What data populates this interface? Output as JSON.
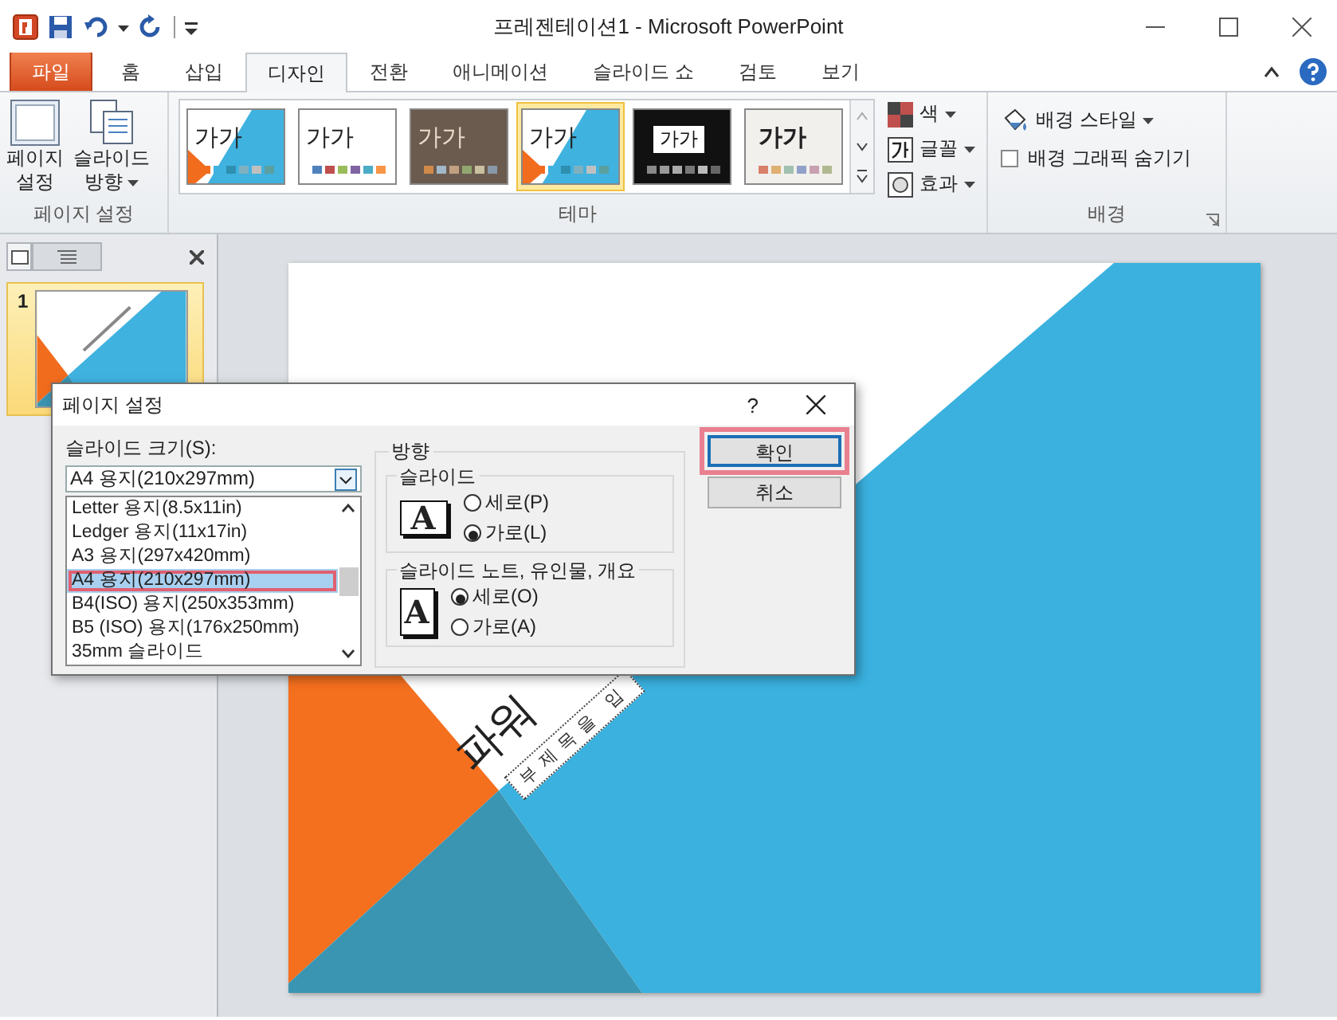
{
  "window": {
    "title": "프레젠테이션1 - Microsoft PowerPoint"
  },
  "tabs": [
    {
      "label": "파일",
      "kind": "file",
      "selected": false
    },
    {
      "label": "홈",
      "kind": "normal",
      "selected": false
    },
    {
      "label": "삽입",
      "kind": "normal",
      "selected": false
    },
    {
      "label": "디자인",
      "kind": "normal",
      "selected": true
    },
    {
      "label": "전환",
      "kind": "normal",
      "selected": false
    },
    {
      "label": "애니메이션",
      "kind": "normal",
      "selected": false
    },
    {
      "label": "슬라이드 쇼",
      "kind": "normal",
      "selected": false
    },
    {
      "label": "검토",
      "kind": "normal",
      "selected": false
    },
    {
      "label": "보기",
      "kind": "normal",
      "selected": false
    }
  ],
  "ribbon": {
    "page_setup": {
      "label": "페이지 설정",
      "buttons": [
        {
          "lines": [
            "페이지",
            "설정"
          ],
          "kind": "setup",
          "dropdown": false
        },
        {
          "lines": [
            "슬라이드",
            "방향"
          ],
          "kind": "orientation",
          "dropdown": true
        }
      ]
    },
    "themes": {
      "label": "테마",
      "items": [
        {
          "label": "가가",
          "kind": "facet",
          "selected": false
        },
        {
          "label": "가가",
          "kind": "office",
          "selected": false
        },
        {
          "label": "가가",
          "kind": "brown",
          "selected": false
        },
        {
          "label": "가가",
          "kind": "facet",
          "selected": true
        },
        {
          "label": "가가",
          "kind": "dark",
          "selected": false
        },
        {
          "label": "가가",
          "kind": "paper",
          "selected": false
        }
      ],
      "options": [
        {
          "label": "색",
          "kind": "colors"
        },
        {
          "label": "글꼴",
          "kind": "fonts"
        },
        {
          "label": "효과",
          "kind": "effects"
        }
      ]
    },
    "background": {
      "label": "배경",
      "style_button": "배경 스타일",
      "hide_graphics": {
        "label": "배경 그래픽 숨기기",
        "checked": false
      }
    }
  },
  "slides_panel": {
    "slides": [
      {
        "number": "1",
        "selected": true
      }
    ]
  },
  "slide": {
    "title": "파워",
    "subtitle": "부제목을 입"
  },
  "dialog": {
    "title": "페이지 설정",
    "help": "?",
    "size_label": "슬라이드 크기(S):",
    "size_value": "A4 용지(210x297mm)",
    "size_options": [
      {
        "label": "Letter 용지(8.5x11in)",
        "selected": false,
        "highlighted": false
      },
      {
        "label": "Ledger 용지(11x17in)",
        "selected": false,
        "highlighted": false
      },
      {
        "label": "A3 용지(297x420mm)",
        "selected": false,
        "highlighted": false
      },
      {
        "label": "A4 용지(210x297mm)",
        "selected": true,
        "highlighted": true
      },
      {
        "label": "B4(ISO) 용지(250x353mm)",
        "selected": false,
        "highlighted": false
      },
      {
        "label": "B5 (ISO) 용지(176x250mm)",
        "selected": false,
        "highlighted": false
      },
      {
        "label": "35mm 슬라이드",
        "selected": false,
        "highlighted": false
      }
    ],
    "orientation_label": "방향",
    "orientation_groups": [
      {
        "label": "슬라이드",
        "kind": "landscape",
        "icon_text": "A",
        "options": [
          {
            "label": "세로(P)",
            "selected": false
          },
          {
            "label": "가로(L)",
            "selected": true
          }
        ]
      },
      {
        "label": "슬라이드 노트, 유인물, 개요",
        "kind": "portrait",
        "icon_text": "A",
        "options": [
          {
            "label": "세로(O)",
            "selected": true
          },
          {
            "label": "가로(A)",
            "selected": false
          }
        ]
      }
    ],
    "buttons": [
      {
        "label": "확인",
        "highlighted": true
      },
      {
        "label": "취소",
        "highlighted": false
      }
    ]
  }
}
